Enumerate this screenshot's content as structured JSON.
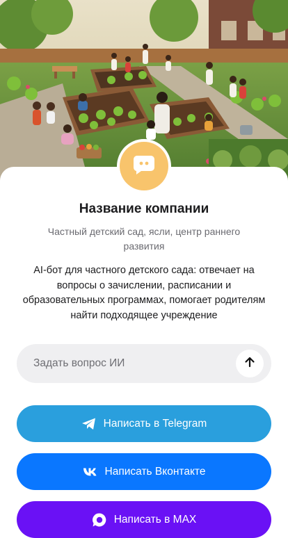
{
  "company": {
    "name": "Название компании",
    "subtitle": "Частный детский сад, ясли, центр раннего развития",
    "description": "AI-бот для частного детского сада: отвечает на вопросы о зачислении, расписании и образовательных программах, помогает родителям найти подходящее учреждение",
    "avatar_icon": "chat-bubble-icon",
    "avatar_color": "#f8c46c"
  },
  "ask": {
    "placeholder": "Задать вопрос ИИ",
    "send_icon": "arrow-up-icon"
  },
  "buttons": {
    "telegram": {
      "label": "Написать в Telegram",
      "icon": "telegram-icon",
      "color": "#2a9fdd"
    },
    "vk": {
      "label": "Написать Вконтакте",
      "icon": "vk-icon",
      "color": "#0a77ff"
    },
    "max": {
      "label": "Написать в MAX",
      "icon": "max-icon",
      "color": "#6a11f5"
    }
  }
}
